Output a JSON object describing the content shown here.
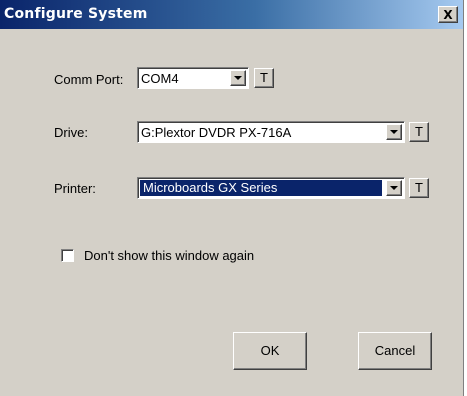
{
  "window": {
    "title": "Configure System",
    "close_label": "X"
  },
  "comm_port": {
    "label": "Comm Port:",
    "value": "COM4",
    "t_label": "T"
  },
  "drive": {
    "label": "Drive:",
    "value": "G:Plextor DVDR  PX-716A",
    "t_label": "T"
  },
  "printer": {
    "label": "Printer:",
    "value": "Microboards GX Series",
    "t_label": "T"
  },
  "dont_show": {
    "label": "Don't show this window again",
    "checked": false
  },
  "buttons": {
    "ok_label": "OK",
    "cancel_label": "Cancel"
  },
  "colors": {
    "titlebar_start": "#0a246a",
    "titlebar_end": "#a6caf0",
    "face": "#d4d0c8",
    "selection": "#0a246a"
  }
}
